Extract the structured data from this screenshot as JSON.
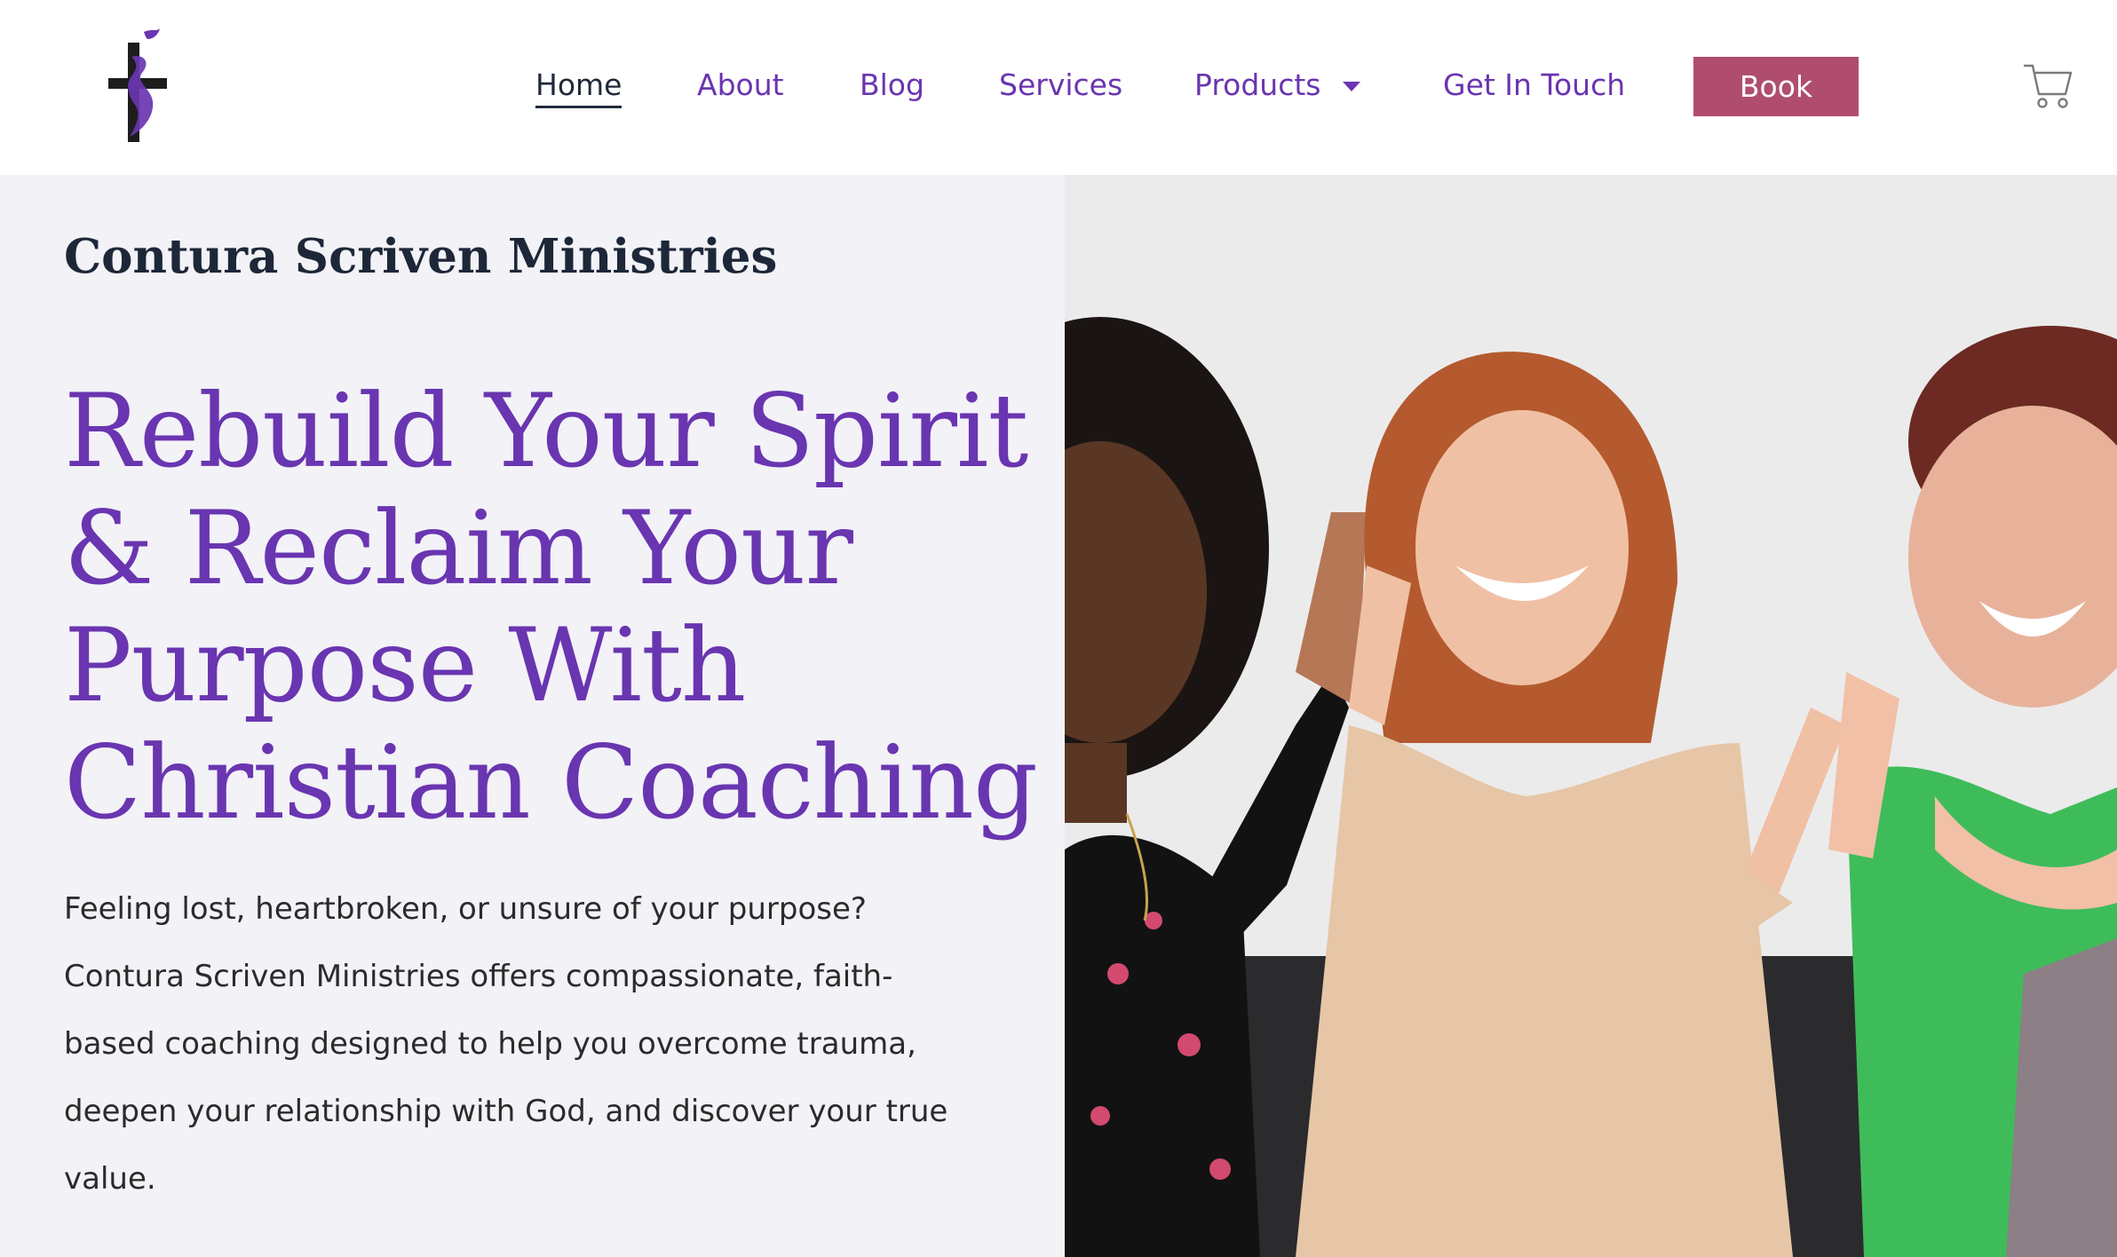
{
  "header": {
    "logo_name": "cross-dove-logo",
    "nav": {
      "home": "Home",
      "about": "About",
      "blog": "Blog",
      "services": "Services",
      "products": "Products",
      "get_in_touch": "Get In Touch"
    },
    "book_label": "Book",
    "cart_icon": "shopping-cart-icon"
  },
  "hero": {
    "brand": "Contura Scriven Ministries",
    "title_lines": [
      "Rebuild Your Spirit",
      "& Reclaim Your",
      "Purpose With",
      "Christian Coaching"
    ],
    "description": "Feeling lost, heartbroken, or unsure of your purpose? Contura Scriven Ministries offers compassionate, faith-based coaching designed to help you overcome trauma, deepen your relationship with God, and discover your true value."
  },
  "colors": {
    "accent_purple": "#6a35b0",
    "book_button": "#b04d6e",
    "dark_text": "#1d2738",
    "panel_bg": "#f2f2f7"
  }
}
